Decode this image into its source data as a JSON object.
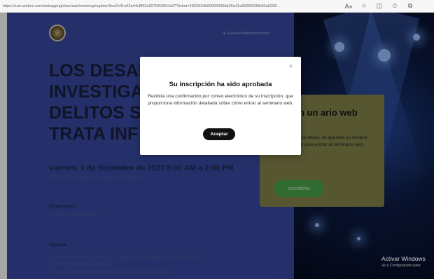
{
  "browser": {
    "url": "https://saic.webex.com/webappng/sites/saic/meeting/register/9ca7e41e62a44c8f92c607546301fa97?ticket=4832534b00000006db26a41a59283630b50a6208...",
    "icons": [
      "read-aloud-icon",
      "favorite-star-icon",
      "split-screen-icon",
      "favorites-icon",
      "collections-icon"
    ]
  },
  "event": {
    "language": "⊕ Español latinoamericano",
    "title": "LOS DESAFÍOS DE LA INVESTIGACIÓN DE DELITOS SEXUALES Y TRATA INFANTIL",
    "title_visible_lines": [
      "LOS DESAF",
      "INVESTIGA",
      "DELITOS S",
      "TRATA INF"
    ],
    "date": "viernes, 1 de diciembre de 2023 8:00 AM a 2:00 PM",
    "timezone": "(UTC-05:00) Bogotá, Lima, Quito, Río Branco",
    "organizer_label": "Organizador",
    "organizer": "ICITAP Centroamérica",
    "agenda_label": "Agenda",
    "agenda_line1": "Dr. JAVIER AUGUSTO ROJAS: Médico especializado en Psiquiatría",
    "agenda_line2": "Forense, Perfilador Criminal.",
    "agenda_line3": "Tema: Caracterización del Agresor Sexual de Menores."
  },
  "registration": {
    "title": "irse en un ario web",
    "text": "iste, inscríbase ahora. se apruebe su recibirá una invitación para entrar al seminario web.",
    "button": "Inscribirse"
  },
  "modal": {
    "close": "×",
    "title": "Su inscripción ha sido aprobada",
    "text": "Recibirá una confirmación por correo electrónico de su inscripción, que proporciona información detallada sobre cómo entrar al seminario web.",
    "button": "Aceptar"
  },
  "windows": {
    "activate_title": "Activar Windows",
    "activate_sub": "Ve a Configuración para"
  },
  "colors": {
    "left_panel": "#3a4aa4",
    "reg_button": "#4aa74c",
    "modal_button": "#111111"
  }
}
